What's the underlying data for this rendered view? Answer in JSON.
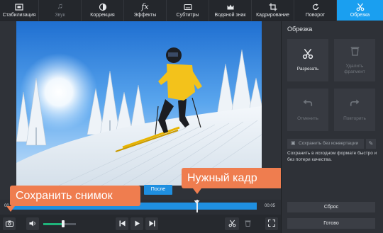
{
  "toolbar": {
    "tabs": [
      {
        "label": "Стабилизация",
        "icon": "stabilize-icon",
        "state": "normal"
      },
      {
        "label": "Звук",
        "icon": "music-note-icon",
        "state": "disabled"
      },
      {
        "label": "Коррекция",
        "icon": "contrast-icon",
        "state": "normal"
      },
      {
        "label": "Эффекты",
        "icon": "fx-icon",
        "state": "normal"
      },
      {
        "label": "Субтитры",
        "icon": "subtitles-icon",
        "state": "normal"
      },
      {
        "label": "Водяной знак",
        "icon": "crown-icon",
        "state": "normal"
      },
      {
        "label": "Кадрирование",
        "icon": "crop-icon",
        "state": "normal"
      },
      {
        "label": "Поворот",
        "icon": "rotate-icon",
        "state": "normal"
      },
      {
        "label": "Обрезка",
        "icon": "scissors-icon",
        "state": "active"
      }
    ]
  },
  "player": {
    "after_label": "После",
    "time_start": "00",
    "time_end": "00:05",
    "playhead_fraction": 0.75,
    "volume_fraction": 0.6
  },
  "callouts": {
    "snapshot": "Сохранить снимок",
    "frame": "Нужный кадр"
  },
  "panel": {
    "title": "Обрезка",
    "cut_label": "Разрезать",
    "delete_label": "Удалить фрагмент",
    "undo_label": "Отменить",
    "redo_label": "Повторить",
    "save_label": "Сохранить без конвертации",
    "save_desc": "Сохранить в исходном формате быстро и без потери качества.",
    "reset_label": "Сброс",
    "done_label": "Готово"
  },
  "colors": {
    "accent": "#1a9ff0",
    "callout": "#ef7d4f",
    "volume": "#1fb37a"
  }
}
